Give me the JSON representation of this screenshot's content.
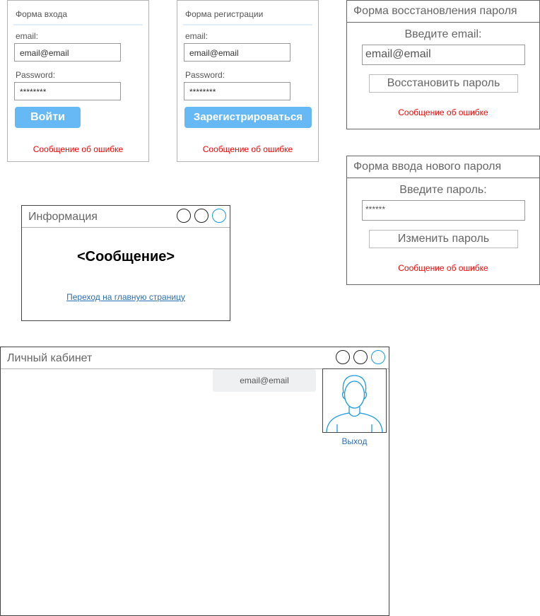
{
  "login_form": {
    "title": "Форма входа",
    "email_label": "email:",
    "email_value": "email@email",
    "password_label": "Password:",
    "password_value": "********",
    "submit_label": "Войти",
    "error": "Сообщение об ошибке"
  },
  "register_form": {
    "title": "Форма регистрации",
    "email_label": "email:",
    "email_value": "email@email",
    "password_label": "Password:",
    "password_value": "********",
    "submit_label": "Зарегистрироваться",
    "error": "Сообщение об ошибке"
  },
  "recover_form": {
    "title": "Форма восстановления пароля",
    "prompt": "Введите email:",
    "email_value": "email@email",
    "submit_label": "Восстановить пароль",
    "error": "Сообщение об ошибке"
  },
  "new_password_form": {
    "title": "Форма ввода нового пароля",
    "prompt": "Введите пароль:",
    "password_value": "******",
    "submit_label": "Изменить пароль",
    "error": "Сообщение об ошибке"
  },
  "info_window": {
    "title": "Информация",
    "message": "<Сообщение>",
    "link": "Переход на главную страницу"
  },
  "cabinet_window": {
    "title": "Личный кабинет",
    "user_email": "email@email",
    "logout": "Выход"
  },
  "colors": {
    "primary_button": "#66b9f5",
    "error": "#ff0000",
    "link": "#2a6fb3",
    "avatar_stroke": "#1a9be0"
  }
}
